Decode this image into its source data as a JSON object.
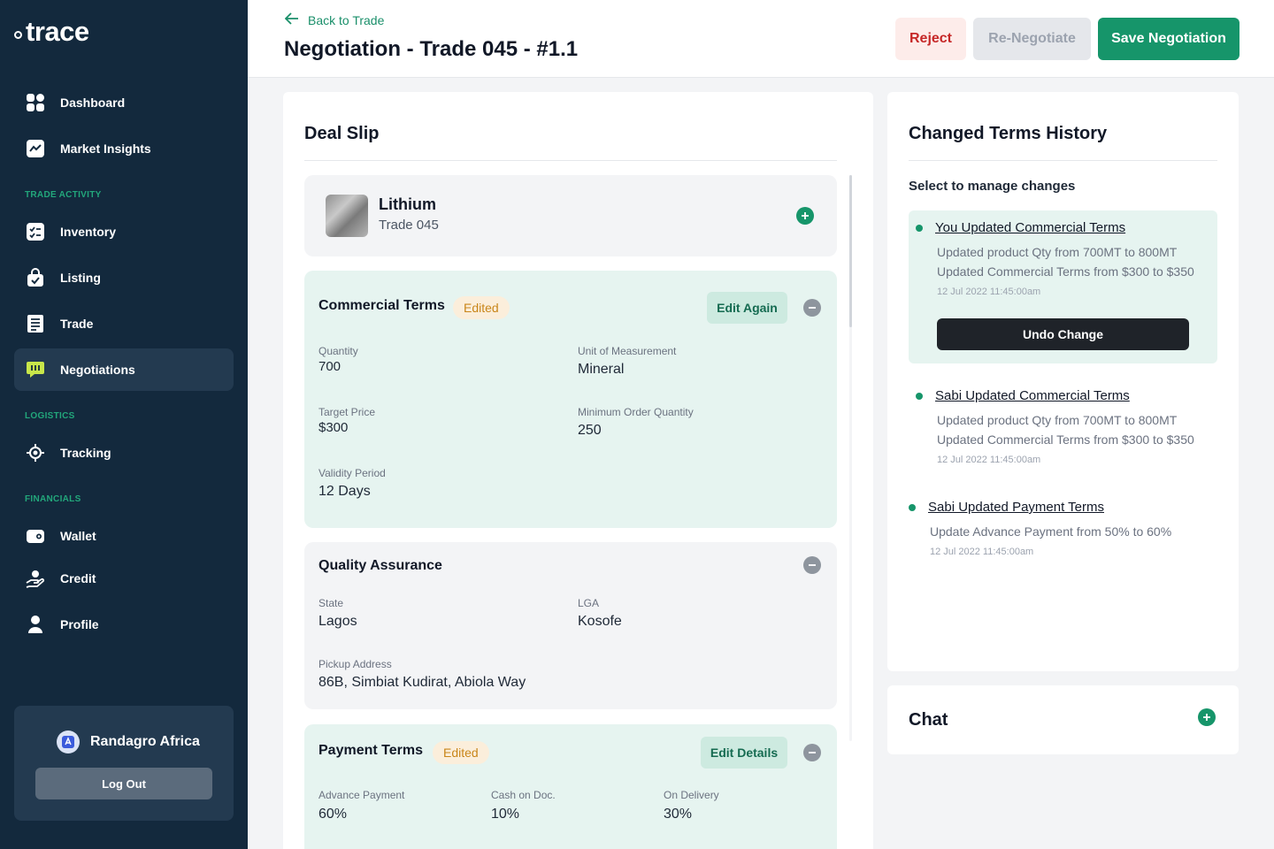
{
  "brand": {
    "name": "trace"
  },
  "sidebar": {
    "items": [
      {
        "label": "Dashboard",
        "icon": "grid-icon"
      },
      {
        "label": "Market Insights",
        "icon": "chart-icon"
      },
      {
        "label": "Inventory",
        "icon": "checklist-icon"
      },
      {
        "label": "Listing",
        "icon": "bag-icon"
      },
      {
        "label": "Trade",
        "icon": "receipt-icon"
      },
      {
        "label": "Negotiations",
        "icon": "chat-bubble-icon",
        "active": true
      },
      {
        "label": "Tracking",
        "icon": "target-icon"
      },
      {
        "label": "Wallet",
        "icon": "wallet-icon"
      },
      {
        "label": "Credit",
        "icon": "hand-coin-icon"
      },
      {
        "label": "Profile",
        "icon": "user-icon"
      }
    ],
    "sections": {
      "trade_activity": "TRADE ACTIVITY",
      "logistics": "LOGISTICS",
      "financials": "FINANCIALS"
    },
    "account": {
      "name": "Randagro Africa",
      "logout_label": "Log Out"
    }
  },
  "header": {
    "back_label": "Back to Trade",
    "title": "Negotiation - Trade 045 - #1.1",
    "reject_label": "Reject",
    "renegotiate_label": "Re-Negotiate",
    "save_label": "Save Negotiation"
  },
  "deal_slip": {
    "title": "Deal Slip",
    "product": {
      "name": "Lithium",
      "trade": "Trade 045"
    },
    "commercial": {
      "title": "Commercial Terms",
      "badge": "Edited",
      "action": "Edit Again",
      "fields": {
        "quantity_label": "Quantity",
        "quantity": "700",
        "uom_label": "Unit of Measurement",
        "uom": "Mineral",
        "target_price_label": "Target Price",
        "target_price": "$300",
        "moq_label": "Minimum Order Quantity",
        "moq": "250",
        "validity_label": "Validity Period",
        "validity": "12 Days"
      }
    },
    "quality": {
      "title": "Quality Assurance",
      "fields": {
        "state_label": "State",
        "state": "Lagos",
        "lga_label": "LGA",
        "lga": "Kosofe",
        "pickup_label": "Pickup Address",
        "pickup": "86B, Simbiat Kudirat, Abiola Way"
      }
    },
    "payment": {
      "title": "Payment Terms",
      "badge": "Edited",
      "action": "Edit Details",
      "fields": {
        "advance_label": "Advance Payment",
        "advance": "60%",
        "cod_label": "Cash on Doc.",
        "cod": "10%",
        "delivery_label": "On Delivery",
        "delivery": "30%"
      }
    }
  },
  "history": {
    "title": "Changed Terms History",
    "subtitle": "Select to manage changes",
    "entries": [
      {
        "title": "You Updated Commercial Terms",
        "lines": [
          "Updated product Qty from 700MT to 800MT",
          "Updated Commercial Terms from $300 to $350"
        ],
        "time": "12 Jul 2022   11:45:00am",
        "action": "Undo Change"
      },
      {
        "title": "Sabi Updated Commercial Terms",
        "lines": [
          "Updated product Qty from 700MT to 800MT",
          "Updated Commercial Terms from $300 to $350"
        ],
        "time": "12 Jul 2022   11:45:00am"
      },
      {
        "title": "Sabi Updated Payment Terms",
        "lines": [
          "Update Advance Payment from 50% to 60%"
        ],
        "time": "12 Jul 2022   11:45:00am"
      }
    ]
  },
  "chat": {
    "title": "Chat"
  },
  "colors": {
    "sidebar": "#13293d",
    "accent": "#16956a",
    "reject": "#c62828",
    "badge": "#c9861a"
  }
}
